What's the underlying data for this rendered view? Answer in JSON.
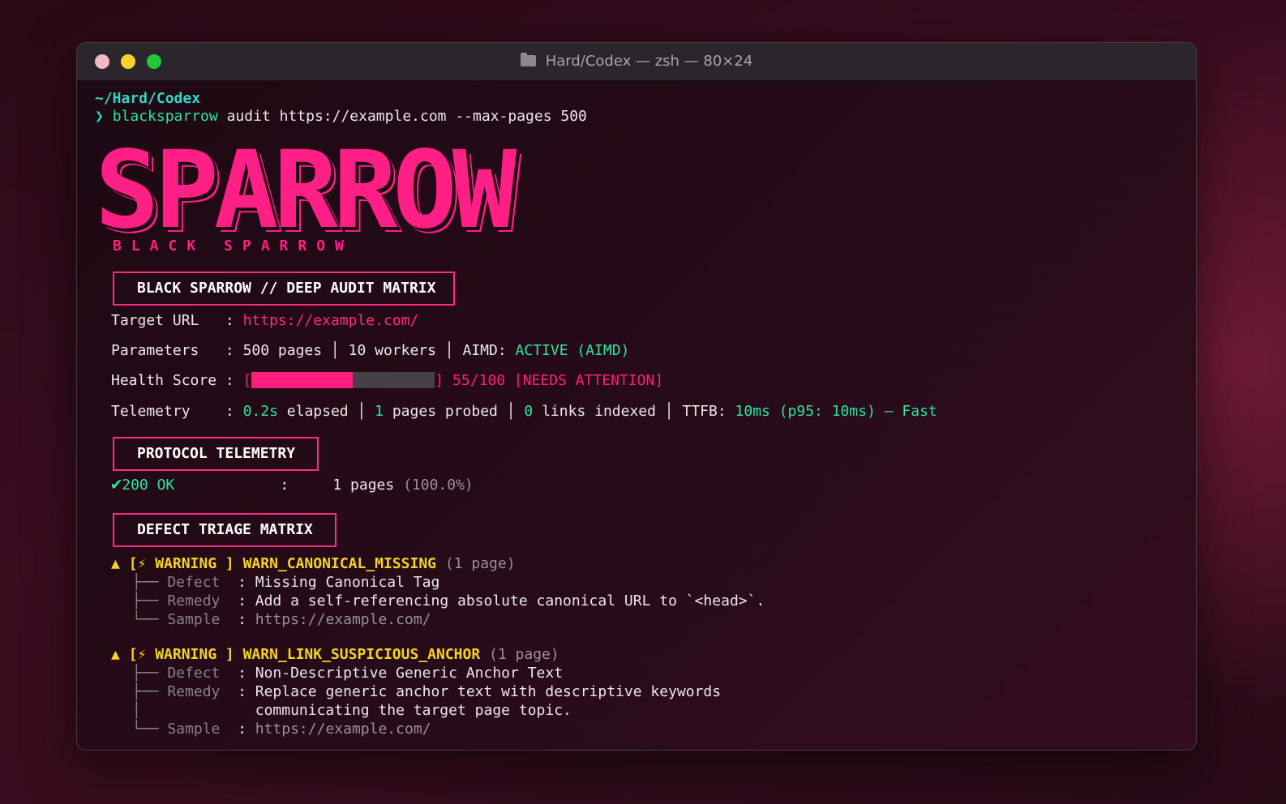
{
  "window": {
    "title": "Hard/Codex — zsh — 80×24",
    "icon": "folder-icon"
  },
  "prompt": {
    "cwd": "~/Hard/Codex",
    "symbol": "❯",
    "command": "blacksparrow",
    "args": "audit https://example.com --max-pages 500"
  },
  "banner": {
    "logo": "SPARROW",
    "subtitle": "BLACK SPARROW"
  },
  "audit": {
    "header": "BLACK SPARROW // DEEP AUDIT MATRIX",
    "target_label": "Target URL   :",
    "target_url": "https://example.com/",
    "params_label": "Parameters   :",
    "params_text": "500 pages │ 10 workers │ AIMD:",
    "aimd_status": "ACTIVE (AIMD)",
    "health_label": "Health Score :",
    "health_open": "[",
    "health_close": "]",
    "health_value": 55,
    "health_max": 100,
    "health_text": "55/100 [NEEDS ATTENTION]",
    "telemetry_label": "Telemetry    :",
    "telemetry": {
      "elapsed": "0.2s",
      "elapsed_label": "elapsed │",
      "probed": "1",
      "probed_label": "pages probed │",
      "links": "0",
      "links_label": "links indexed │ TTFB:",
      "ttfb": "10ms (p95: 10ms) – Fast"
    }
  },
  "protocol": {
    "header": "PROTOCOL TELEMETRY",
    "check": "✔",
    "status": "200 OK",
    "sep": ":",
    "count": "1 pages",
    "pct": "(100.0%)"
  },
  "defects": {
    "header": "DEFECT TRIAGE MATRIX",
    "items": [
      {
        "marker": "▲",
        "level": "[⚡ WARNING ]",
        "code": "WARN_CANONICAL_MISSING",
        "count": "(1 page)",
        "defect_label": "├── Defect",
        "defect": "Missing Canonical Tag",
        "remedy_label": "├── Remedy",
        "remedy": "Add a self-referencing absolute canonical URL to `<head>`.",
        "sample_label": "└── Sample",
        "sample": "https://example.com/"
      },
      {
        "marker": "▲",
        "level": "[⚡ WARNING ]",
        "code": "WARN_LINK_SUSPICIOUS_ANCHOR",
        "count": "(1 page)",
        "defect_label": "├── Defect",
        "defect": "Non-Descriptive Generic Anchor Text",
        "remedy_label": "├── Remedy",
        "remedy": "Replace generic anchor text with descriptive keywords",
        "remedy2": "communicating the target page topic.",
        "sample_label": "└── Sample",
        "sample": "https://example.com/"
      }
    ],
    "field_sep": ":"
  },
  "colors": {
    "accent_pink": "#ff1e7c",
    "accent_green": "#2fe39e",
    "accent_cyan": "#31d8c6",
    "warning_yellow": "#f5d225"
  }
}
